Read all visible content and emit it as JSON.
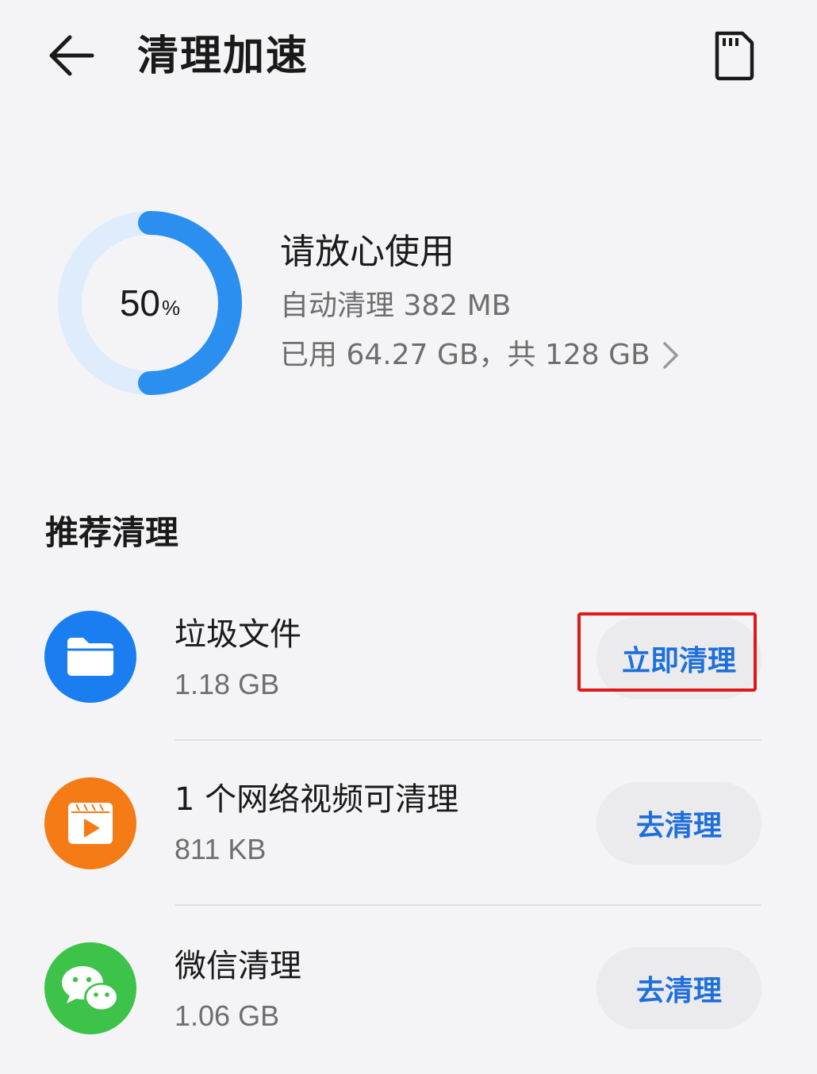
{
  "header": {
    "title": "清理加速",
    "back_icon": "arrow-left-icon",
    "storage_icon": "sd-card-icon"
  },
  "summary": {
    "percent_value": "50",
    "percent_sign": "%",
    "usage_fraction": 0.5,
    "status": "请放心使用",
    "auto_clean": "自动清理 382 MB",
    "storage": "已用 64.27 GB，共 128 GB"
  },
  "section": {
    "title": "推荐清理"
  },
  "items": [
    {
      "name": "垃圾文件",
      "size": "1.18 GB",
      "action": "立即清理",
      "icon": "folder-icon",
      "color": "#1a7ef0"
    },
    {
      "name": "1 个网络视频可清理",
      "size": "811 KB",
      "action": "去清理",
      "icon": "video-icon",
      "color": "#f47b16"
    },
    {
      "name": "微信清理",
      "size": "1.06 GB",
      "action": "去清理",
      "icon": "wechat-icon",
      "color": "#3dc24a"
    }
  ],
  "colors": {
    "ring_track": "#dfecfb",
    "ring_fill": "#2b8ff0",
    "accent": "#1e6fd9",
    "highlight": "#e01818"
  }
}
